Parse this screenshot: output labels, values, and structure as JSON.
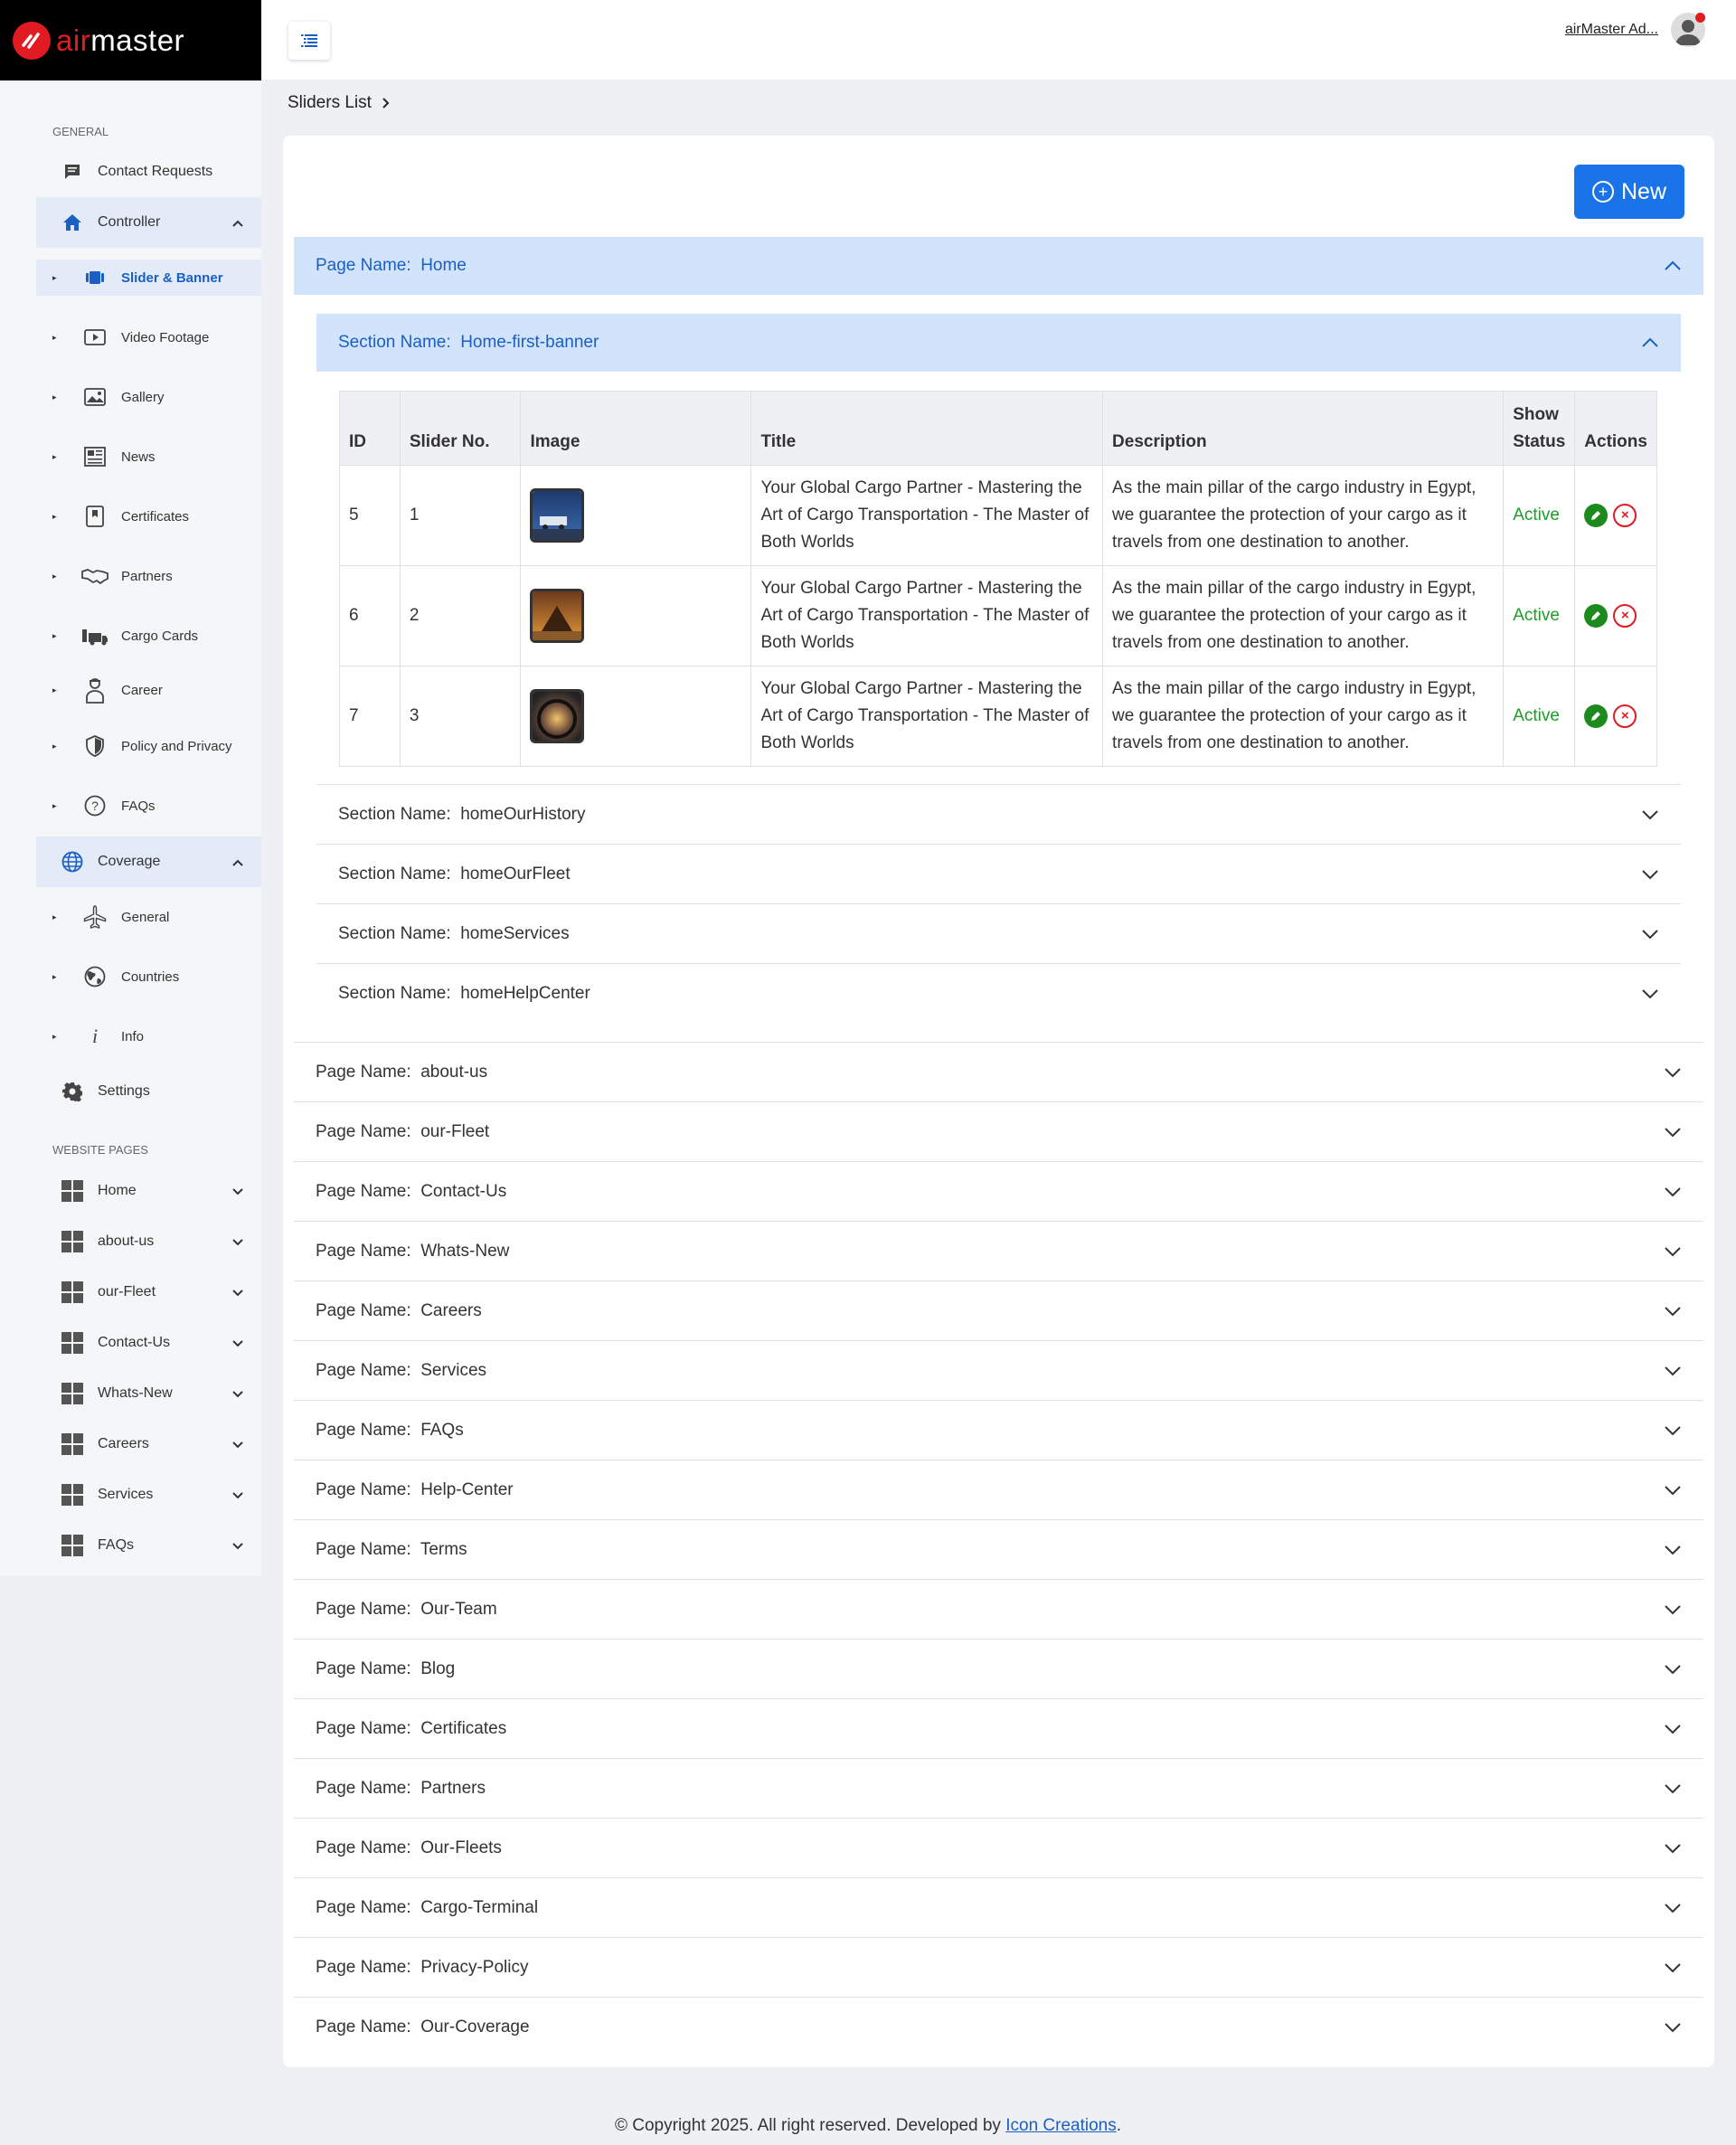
{
  "brand": {
    "logo_air": "air",
    "logo_master": "master"
  },
  "sidebar": {
    "general_heading": "GENERAL",
    "contact_requests": "Contact Requests",
    "controller": "Controller",
    "controller_items": [
      {
        "label": "Slider & Banner"
      },
      {
        "label": "Video Footage"
      },
      {
        "label": "Gallery"
      },
      {
        "label": "News"
      },
      {
        "label": "Certificates"
      },
      {
        "label": "Partners"
      },
      {
        "label": "Cargo Cards"
      },
      {
        "label": "Career"
      },
      {
        "label": "Policy and Privacy"
      },
      {
        "label": "FAQs"
      }
    ],
    "coverage": "Coverage",
    "coverage_items": [
      {
        "label": "General"
      },
      {
        "label": "Countries"
      },
      {
        "label": "Info"
      }
    ],
    "settings": "Settings",
    "website_pages_heading": "WEBSITE PAGES",
    "website_pages": [
      {
        "label": "Home"
      },
      {
        "label": "about-us"
      },
      {
        "label": "our-Fleet"
      },
      {
        "label": "Contact-Us"
      },
      {
        "label": "Whats-New"
      },
      {
        "label": "Careers"
      },
      {
        "label": "Services"
      },
      {
        "label": "FAQs"
      }
    ]
  },
  "topbar": {
    "user_name": "airMaster Ad..."
  },
  "breadcrumb": {
    "current": "Sliders List"
  },
  "actions": {
    "new_label": "New"
  },
  "page_prefix": "Page Name:",
  "section_prefix": "Section Name:",
  "open_page": {
    "name": "Home"
  },
  "open_section": {
    "name": "Home-first-banner"
  },
  "table": {
    "headers": {
      "id": "ID",
      "slider_no": "Slider No.",
      "image": "Image",
      "title": "Title",
      "description": "Description",
      "show_status_1": "Show",
      "show_status_2": "Status",
      "actions": "Actions"
    },
    "rows": [
      {
        "id": "5",
        "slider_no": "1",
        "title": "Your Global Cargo Partner - Mastering the Art of Cargo Transportation - The Master of Both Worlds",
        "description": "As the main pillar of the cargo industry in Egypt, we guarantee the protection of your cargo as it travels from one destination to another.",
        "status": "Active"
      },
      {
        "id": "6",
        "slider_no": "2",
        "title": "Your Global Cargo Partner - Mastering the Art of Cargo Transportation - The Master of Both Worlds",
        "description": "As the main pillar of the cargo industry in Egypt, we guarantee the protection of your cargo as it travels from one destination to another.",
        "status": "Active"
      },
      {
        "id": "7",
        "slider_no": "3",
        "title": "Your Global Cargo Partner - Mastering the Art of Cargo Transportation - The Master of Both Worlds",
        "description": "As the main pillar of the cargo industry in Egypt, we guarantee the protection of your cargo as it travels from one destination to another.",
        "status": "Active"
      }
    ]
  },
  "collapsed_sections": [
    "homeOurHistory",
    "homeOurFleet",
    "homeServices",
    "homeHelpCenter"
  ],
  "collapsed_pages": [
    "about-us",
    "our-Fleet",
    "Contact-Us",
    "Whats-New",
    "Careers",
    "Services",
    "FAQs",
    "Help-Center",
    "Terms",
    "Our-Team",
    "Blog",
    "Certificates",
    "Partners",
    "Our-Fleets",
    "Cargo-Terminal",
    "Privacy-Policy",
    "Our-Coverage"
  ],
  "footer": {
    "text": "© Copyright 2025. All right reserved. Developed by ",
    "link": "Icon Creations",
    "end": "."
  },
  "colors": {
    "accent": "#1a73e8",
    "brand_red": "#e21b23",
    "active_green": "#1e9c2a",
    "open_row_bg": "#d2e3fc"
  }
}
